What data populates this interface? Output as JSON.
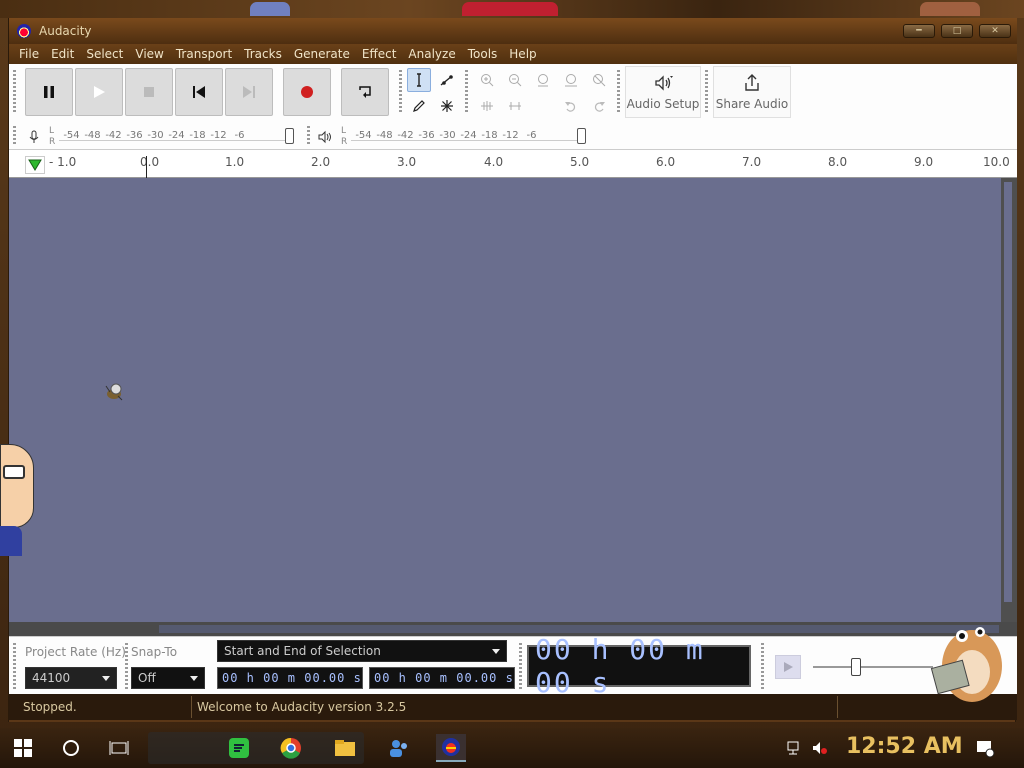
{
  "window": {
    "title": "Audacity"
  },
  "menu": [
    "File",
    "Edit",
    "Select",
    "View",
    "Transport",
    "Tracks",
    "Generate",
    "Effect",
    "Analyze",
    "Tools",
    "Help"
  ],
  "toolbar": {
    "transport": [
      "pause-icon",
      "play-icon",
      "stop-icon",
      "skip-start-icon",
      "skip-end-icon",
      "record-icon",
      "loop-icon"
    ],
    "tools": [
      "selection-tool-icon",
      "envelope-tool-icon",
      "draw-tool-icon",
      "multi-tool-icon"
    ],
    "audio_setup_label": "Audio Setup",
    "share_audio_label": "Share Audio"
  },
  "meters": {
    "lr_label": "L\nR",
    "l": "L",
    "r": "R",
    "scale": [
      "-54",
      "-48",
      "-42",
      "-36",
      "-30",
      "-24",
      "-18",
      "-12",
      "-6"
    ]
  },
  "ruler": {
    "ticks": [
      "- 1.0",
      "0.0",
      "1.0",
      "2.0",
      "3.0",
      "4.0",
      "5.0",
      "6.0",
      "7.0",
      "8.0",
      "9.0",
      "10.0"
    ]
  },
  "selection_toolbar": {
    "project_rate_label": "Project Rate (Hz)",
    "project_rate_value": "44100",
    "snap_to_label": "Snap-To",
    "snap_to_value": "Off",
    "selection_mode": "Start and End of Selection",
    "start_time": "00 h 00 m 00.00 s",
    "end_time": "00 h 00 m 00.00 s",
    "big_time": "00 h 00 m 00 s"
  },
  "status": {
    "left": "Stopped.",
    "right": "Welcome to Audacity version 3.2.5"
  },
  "taskbar": {
    "clock": "12:52 AM"
  },
  "colors": {
    "track_bg": "#6a6e8e",
    "window_frame": "#5b3717",
    "record_red": "#d02020",
    "clock_gold": "#e8c060"
  }
}
